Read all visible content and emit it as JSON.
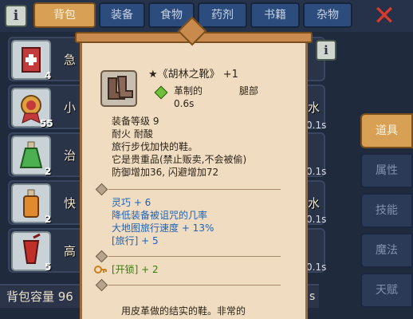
{
  "topbar": {
    "info_icon_glyph": "i",
    "tabs": [
      {
        "label": "背包",
        "active": true
      },
      {
        "label": "装备",
        "active": false
      },
      {
        "label": "食物",
        "active": false
      },
      {
        "label": "药剂",
        "active": false
      },
      {
        "label": "书籍",
        "active": false
      },
      {
        "label": "杂物",
        "active": false
      }
    ],
    "close_glyph": "✕"
  },
  "inventory": {
    "items": [
      {
        "count": "4",
        "name": "急",
        "right_text": "",
        "time": "",
        "icon": "red-book-icon"
      },
      {
        "count": "55",
        "name": "小",
        "right_text": "水",
        "time": "0.1s",
        "icon": "medal-icon"
      },
      {
        "count": "2",
        "name": "治",
        "right_text": "",
        "time": "0.1s",
        "icon": "green-potion-icon"
      },
      {
        "count": "2",
        "name": "快",
        "right_text": "水",
        "time": "0.1s",
        "icon": "orange-potion-icon"
      },
      {
        "count": "5",
        "name": "高",
        "right_text": "",
        "time": "0.1s",
        "icon": "red-drink-icon"
      }
    ],
    "capacity_label": "背包容量 96"
  },
  "side_tabs": [
    {
      "label": "道具",
      "active": true
    },
    {
      "label": "属性",
      "active": false
    },
    {
      "label": "技能",
      "active": false
    },
    {
      "label": "魔法",
      "active": false
    },
    {
      "label": "天赋",
      "active": false
    }
  ],
  "tooltip": {
    "info_glyph": "i",
    "title": "★《胡林之靴》 +1",
    "material": "革制的",
    "slot": "腿部",
    "use_time": "0.6s",
    "item_icon": "boots-icon",
    "material_icon": "green-diamond-icon",
    "desc_lines": [
      "装备等级 9",
      "耐火 耐酸",
      "旅行步伐加快的鞋。",
      "它是贵重品(禁止贩卖,不会被偷)",
      "防御增加36, 闪避增加72"
    ],
    "bonus_lines": [
      "灵巧 + 6",
      "降低装备被诅咒的几率",
      "大地图旅行速度 + 13%",
      "[旅行] + 5"
    ],
    "skill_line": "[开锁] + 2",
    "skill_icon": "key-icon",
    "footer": "用皮革做的结实的鞋。非常的"
  },
  "colors": {
    "panel_bg": "#f0dcc0",
    "panel_border": "#9b6a3c",
    "tab_active": "#d8a055",
    "tab_inactive": "#2b4c7c",
    "bonus_blue": "#1f62b8",
    "skill_green": "#3b7a12",
    "close_red": "#d83a2e"
  }
}
